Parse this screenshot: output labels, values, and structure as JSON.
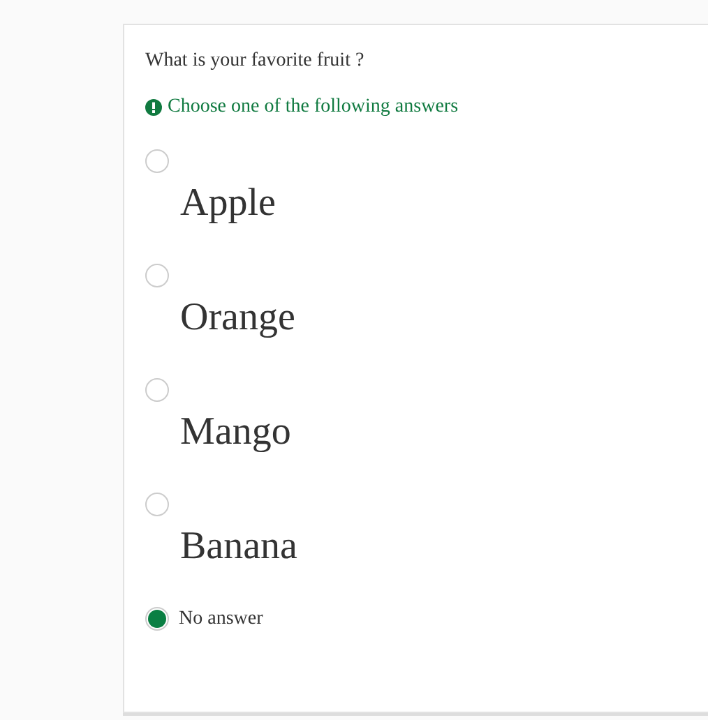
{
  "question": {
    "title": "What is your favorite fruit ?",
    "hint": "Choose one of the following answers"
  },
  "answers": [
    {
      "kind": "large",
      "label": "Apple",
      "selected": false
    },
    {
      "kind": "large",
      "label": "Orange",
      "selected": false
    },
    {
      "kind": "large",
      "label": "Mango",
      "selected": false
    },
    {
      "kind": "large",
      "label": "Banana",
      "selected": false
    },
    {
      "kind": "inline",
      "label": "No answer",
      "selected": true
    }
  ]
}
